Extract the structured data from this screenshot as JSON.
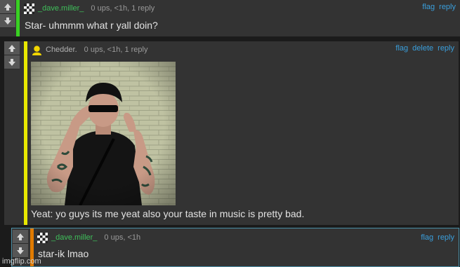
{
  "comments": [
    {
      "username": "_dave.miller_",
      "meta": "0 ups, <1h, 1 reply",
      "actions": [
        "flag",
        "reply"
      ],
      "text": "Star- uhmmm what r yall doin?"
    },
    {
      "username": "Chedder.",
      "meta": "0 ups, <1h, 1 reply",
      "actions": [
        "flag",
        "delete",
        "reply"
      ],
      "text": "Yeat: yo guys its me yeat also your taste in music is pretty bad."
    },
    {
      "username": "_dave.miller_",
      "meta": "0 ups, <1h",
      "actions": [
        "flag",
        "reply"
      ],
      "text": "star-ik lmao"
    }
  ],
  "watermark": "imgflip.com",
  "colors": {
    "accent_green": "#39d023",
    "accent_yellow": "#e8e800",
    "accent_orange": "#e07b00",
    "link_blue": "#3a9fdc",
    "username_green": "#3fbf5a"
  }
}
